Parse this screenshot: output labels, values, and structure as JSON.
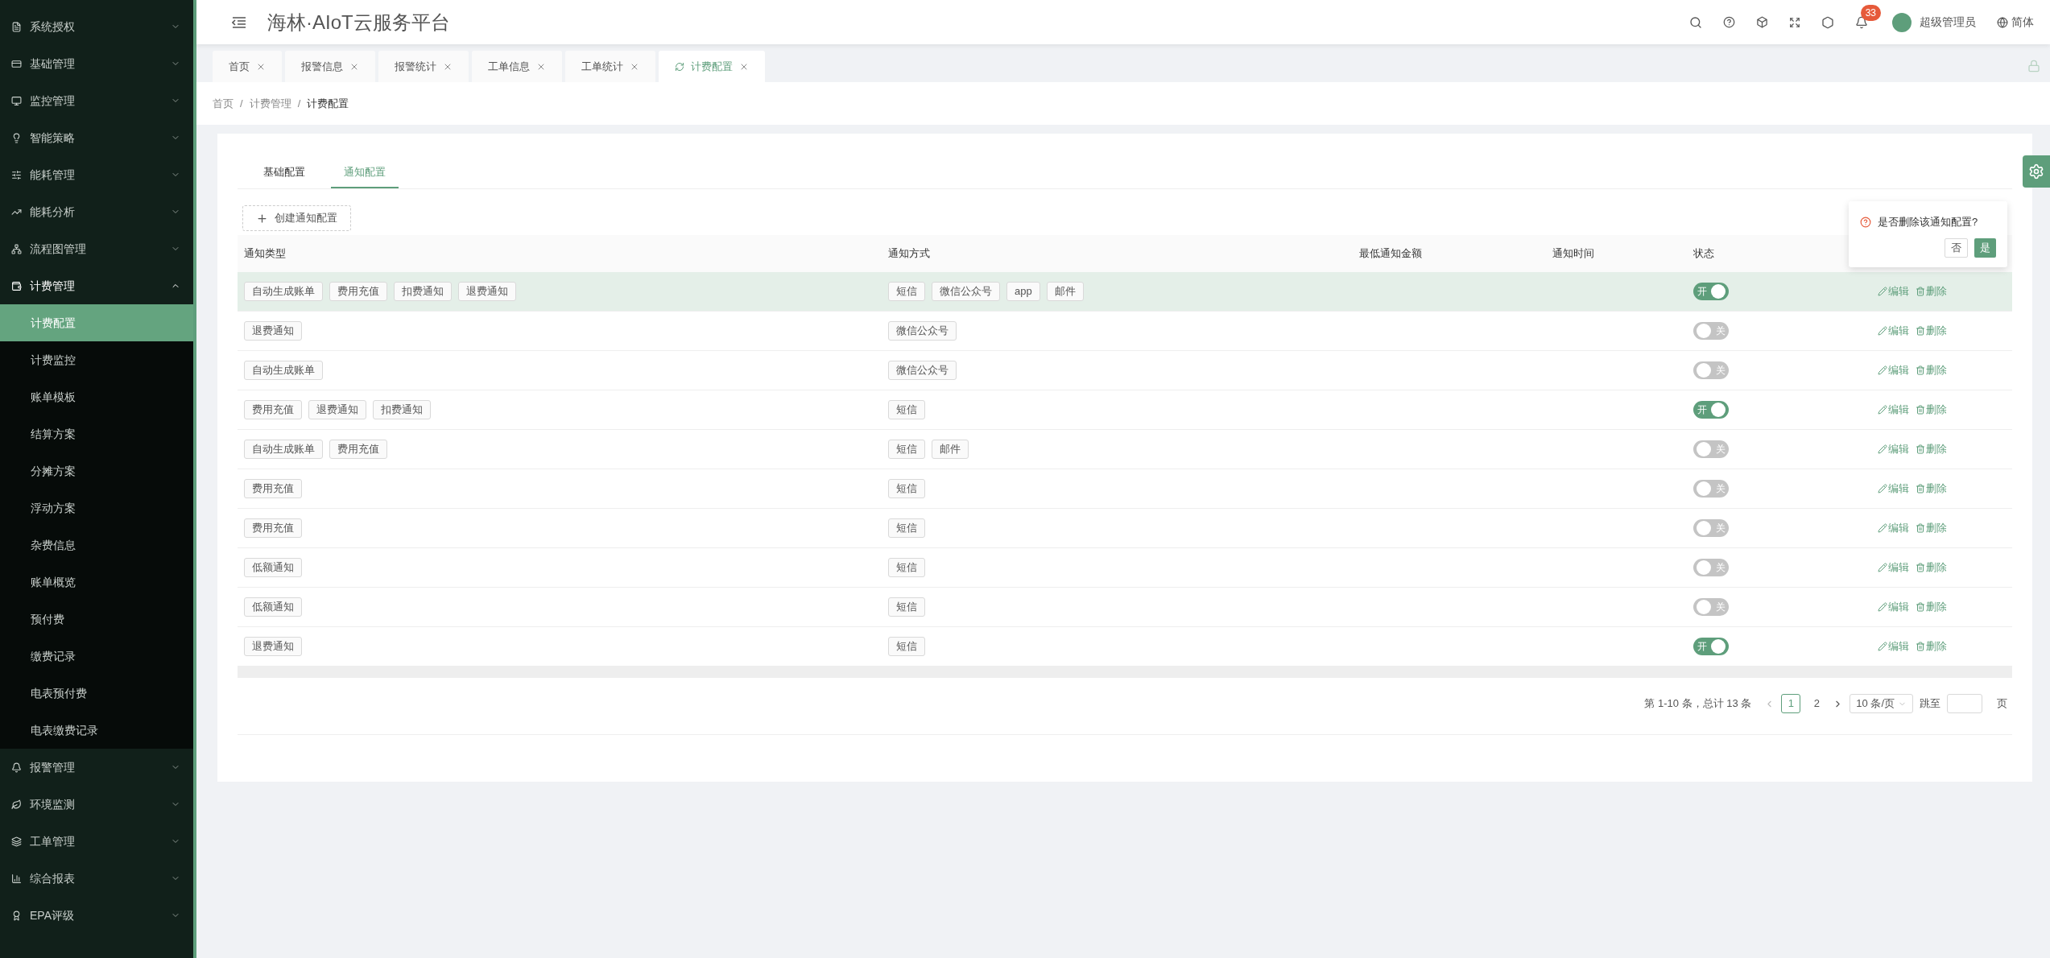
{
  "sidebar": {
    "items": [
      {
        "label": "系统授权",
        "expanded": false
      },
      {
        "label": "基础管理",
        "expanded": false
      },
      {
        "label": "监控管理",
        "expanded": false
      },
      {
        "label": "智能策略",
        "expanded": false
      },
      {
        "label": "能耗管理",
        "expanded": false
      },
      {
        "label": "能耗分析",
        "expanded": false
      },
      {
        "label": "流程图管理",
        "expanded": false
      },
      {
        "label": "计费管理",
        "expanded": true,
        "children": [
          {
            "label": "计费配置",
            "selected": true
          },
          {
            "label": "计费监控",
            "selected": false
          },
          {
            "label": "账单模板",
            "selected": false
          },
          {
            "label": "结算方案",
            "selected": false
          },
          {
            "label": "分摊方案",
            "selected": false
          },
          {
            "label": "浮动方案",
            "selected": false
          },
          {
            "label": "杂费信息",
            "selected": false
          },
          {
            "label": "账单概览",
            "selected": false
          },
          {
            "label": "预付费",
            "selected": false
          },
          {
            "label": "缴费记录",
            "selected": false
          },
          {
            "label": "电表预付费",
            "selected": false
          },
          {
            "label": "电表缴费记录",
            "selected": false
          }
        ]
      },
      {
        "label": "报警管理",
        "expanded": false
      },
      {
        "label": "环境监测",
        "expanded": false
      },
      {
        "label": "工单管理",
        "expanded": false
      },
      {
        "label": "综合报表",
        "expanded": false
      },
      {
        "label": "EPA评级",
        "expanded": false
      }
    ]
  },
  "header": {
    "title": "海林·AIoT云服务平台",
    "notification_count": "33",
    "user": "超级管理员",
    "language": "简体"
  },
  "tabs": [
    {
      "label": "首页",
      "selected": false
    },
    {
      "label": "报警信息",
      "selected": false
    },
    {
      "label": "报警统计",
      "selected": false
    },
    {
      "label": "工单信息",
      "selected": false
    },
    {
      "label": "工单统计",
      "selected": false
    },
    {
      "label": "计费配置",
      "selected": true
    }
  ],
  "breadcrumb": [
    {
      "label": "首页"
    },
    {
      "separator": "/",
      "label": "计费管理"
    },
    {
      "separator": "/",
      "label": "计费配置"
    }
  ],
  "config_tabs": [
    {
      "label": "基础配置",
      "selected": false
    },
    {
      "label": "通知配置",
      "selected": true
    }
  ],
  "create_button": "创建通知配置",
  "table": {
    "columns": [
      "通知类型",
      "通知方式",
      "最低通知金额",
      "通知时间",
      "状态"
    ],
    "rows": [
      {
        "types": [
          "自动生成账单",
          "费用充值",
          "扣费通知",
          "退费通知"
        ],
        "methods": [
          "短信",
          "微信公众号",
          "app",
          "邮件"
        ],
        "on": true,
        "status": "开",
        "selected": true,
        "actions": [
          "编辑",
          "删除"
        ]
      },
      {
        "types": [
          "退费通知"
        ],
        "methods": [
          "微信公众号"
        ],
        "on": false,
        "status": "关",
        "selected": false,
        "actions": [
          "编辑",
          "删除"
        ]
      },
      {
        "types": [
          "自动生成账单"
        ],
        "methods": [
          "微信公众号"
        ],
        "on": false,
        "status": "关",
        "selected": false,
        "actions": [
          "编辑",
          "删除"
        ]
      },
      {
        "types": [
          "费用充值",
          "退费通知",
          "扣费通知"
        ],
        "methods": [
          "短信"
        ],
        "on": true,
        "status": "开",
        "selected": false,
        "actions": [
          "编辑",
          "删除"
        ]
      },
      {
        "types": [
          "自动生成账单",
          "费用充值"
        ],
        "methods": [
          "短信",
          "邮件"
        ],
        "on": false,
        "status": "关",
        "selected": false,
        "actions": [
          "编辑",
          "删除"
        ]
      },
      {
        "types": [
          "费用充值"
        ],
        "methods": [
          "短信"
        ],
        "on": false,
        "status": "关",
        "selected": false,
        "actions": [
          "编辑",
          "删除"
        ]
      },
      {
        "types": [
          "费用充值"
        ],
        "methods": [
          "短信"
        ],
        "on": false,
        "status": "关",
        "selected": false,
        "actions": [
          "编辑",
          "删除"
        ]
      },
      {
        "types": [
          "低额通知"
        ],
        "methods": [
          "短信"
        ],
        "on": false,
        "status": "关",
        "selected": false,
        "actions": [
          "编辑",
          "删除"
        ]
      },
      {
        "types": [
          "低额通知"
        ],
        "methods": [
          "短信"
        ],
        "on": false,
        "status": "关",
        "selected": false,
        "actions": [
          "编辑",
          "删除"
        ]
      },
      {
        "types": [
          "退费通知"
        ],
        "methods": [
          "短信"
        ],
        "on": true,
        "status": "开",
        "selected": false,
        "actions": [
          "编辑",
          "删除"
        ]
      }
    ]
  },
  "popconfirm": {
    "message": "是否删除该通知配置?",
    "buttons": [
      {
        "label": "否",
        "kind": "default"
      },
      {
        "label": "是",
        "kind": "primary"
      }
    ]
  },
  "pagination": {
    "summary": "第 1-10 条，总计 13 条",
    "pages": [
      {
        "label": "1",
        "selected": true
      },
      {
        "label": "2",
        "selected": false
      }
    ],
    "page_size": "10 条/页",
    "jump_label": "跳至",
    "jump_suffix": "页"
  }
}
